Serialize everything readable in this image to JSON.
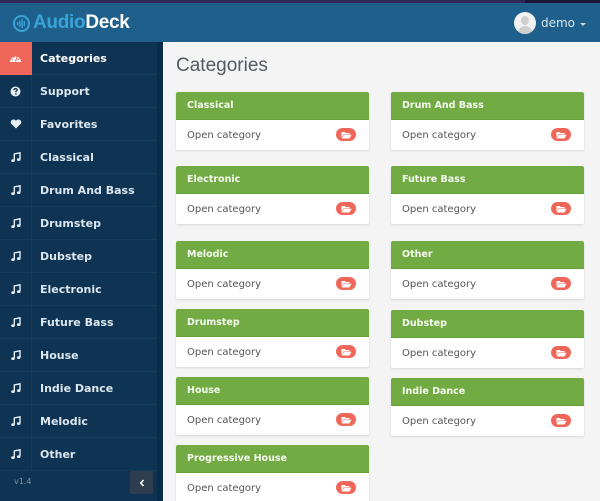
{
  "app": {
    "logo": {
      "part1": "Audio",
      "part2": "Deck"
    },
    "user": {
      "name": "demo"
    }
  },
  "colors": {
    "header": "#1f5f8b",
    "sidebar": "#0f3352",
    "active": "#f0675a",
    "panel_header": "#72ab44",
    "background": "#f4f4f4"
  },
  "sidebar": {
    "items": [
      {
        "label": "Categories",
        "icon": "dashboard-icon",
        "active": true
      },
      {
        "label": "Support",
        "icon": "question-circle-icon",
        "active": false
      },
      {
        "label": "Favorites",
        "icon": "heart-icon",
        "active": false
      },
      {
        "label": "Classical",
        "icon": "music-note-icon",
        "active": false
      },
      {
        "label": "Drum And Bass",
        "icon": "music-note-icon",
        "active": false
      },
      {
        "label": "Drumstep",
        "icon": "music-note-icon",
        "active": false
      },
      {
        "label": "Dubstep",
        "icon": "music-note-icon",
        "active": false
      },
      {
        "label": "Electronic",
        "icon": "music-note-icon",
        "active": false
      },
      {
        "label": "Future Bass",
        "icon": "music-note-icon",
        "active": false
      },
      {
        "label": "House",
        "icon": "music-note-icon",
        "active": false
      },
      {
        "label": "Indie Dance",
        "icon": "music-note-icon",
        "active": false
      },
      {
        "label": "Melodic",
        "icon": "music-note-icon",
        "active": false
      },
      {
        "label": "Other",
        "icon": "music-note-icon",
        "active": false
      }
    ],
    "version": "v1.4",
    "collapse_icon": "chevron-left-icon"
  },
  "main": {
    "title": "Categories",
    "panels": [
      {
        "title": "Classical",
        "link": "Open category",
        "icon": "folder-open-icon"
      },
      {
        "title": "Drum And Bass",
        "link": "Open category",
        "icon": "folder-open-icon"
      },
      {
        "title": "Electronic",
        "link": "Open category",
        "icon": "folder-open-icon"
      },
      {
        "title": "Future Bass",
        "link": "Open category",
        "icon": "folder-open-icon"
      },
      {
        "title": "Melodic",
        "link": "Open category",
        "icon": "folder-open-icon"
      },
      {
        "title": "Other",
        "link": "Open category",
        "icon": "folder-open-icon"
      },
      {
        "title": "Drumstep",
        "link": "Open category",
        "icon": "folder-open-icon"
      },
      {
        "title": "Dubstep",
        "link": "Open category",
        "icon": "folder-open-icon"
      },
      {
        "title": "House",
        "link": "Open category",
        "icon": "folder-open-icon"
      },
      {
        "title": "Indie Dance",
        "link": "Open category",
        "icon": "folder-open-icon"
      },
      {
        "title": "Progressive House",
        "link": "Open category",
        "icon": "folder-open-icon"
      }
    ]
  }
}
